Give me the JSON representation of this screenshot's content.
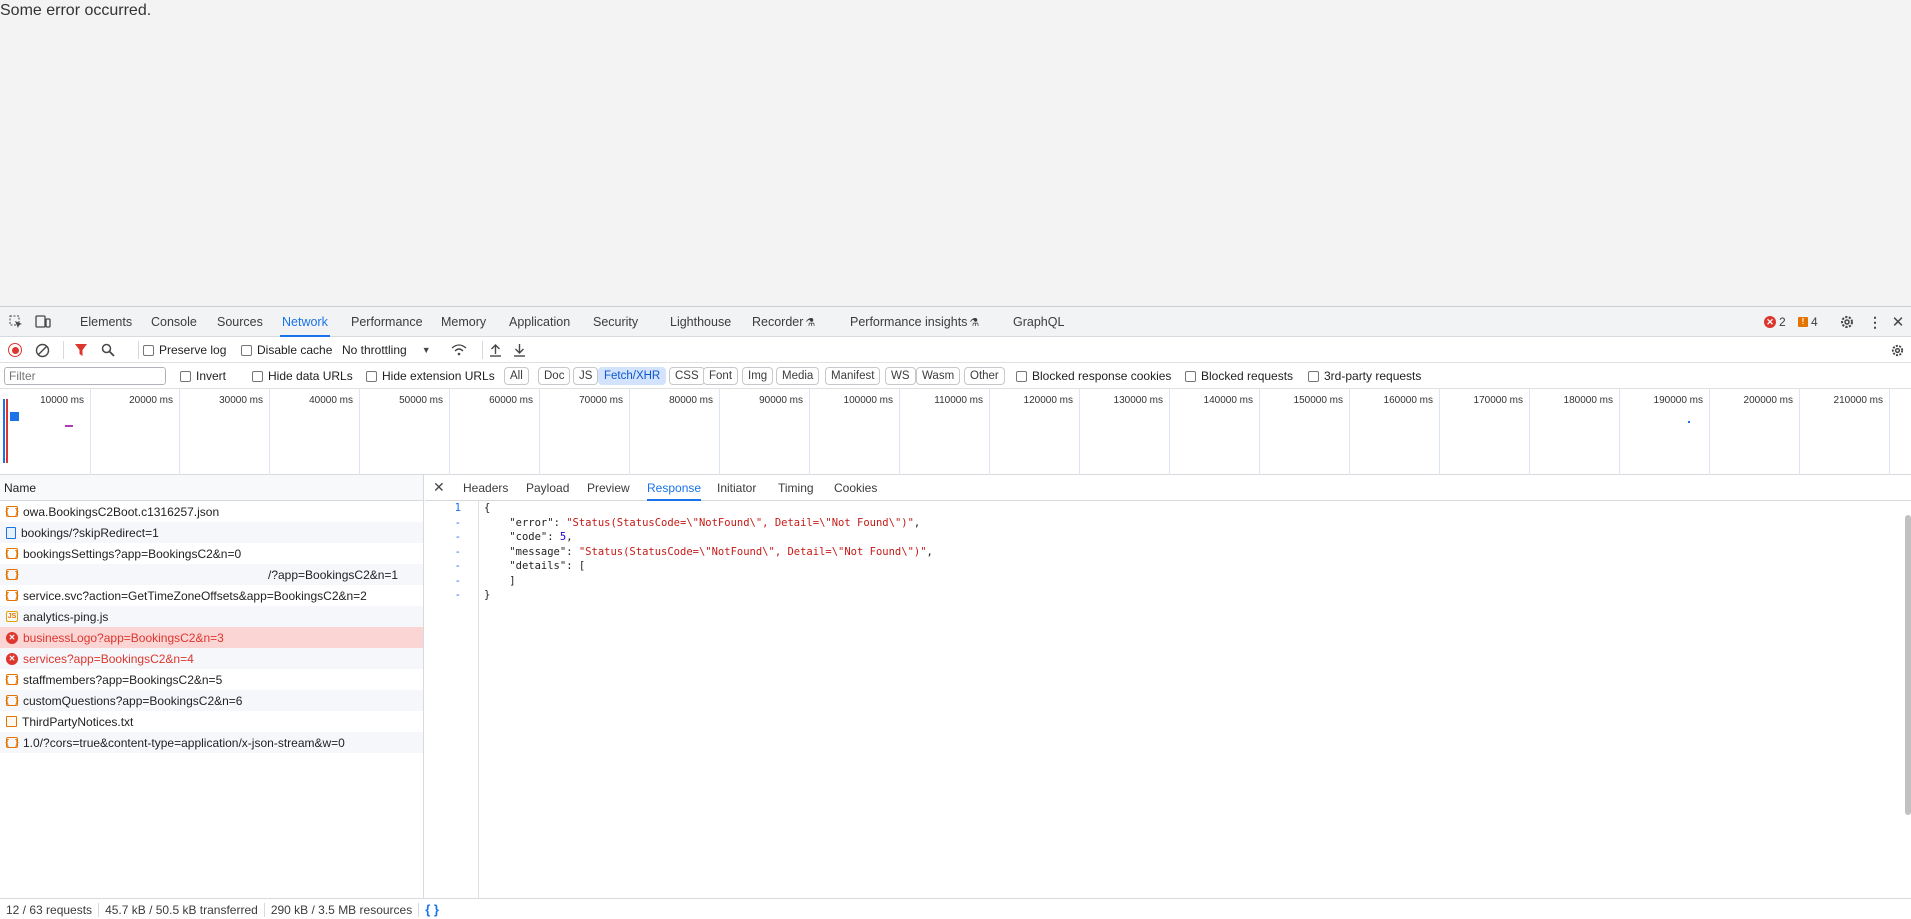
{
  "page": {
    "message": "Some error occurred."
  },
  "tabs": [
    {
      "label": "Elements"
    },
    {
      "label": "Console"
    },
    {
      "label": "Sources"
    },
    {
      "label": "Network"
    },
    {
      "label": "Performance"
    },
    {
      "label": "Memory"
    },
    {
      "label": "Application"
    },
    {
      "label": "Security"
    },
    {
      "label": "Lighthouse"
    },
    {
      "label": "Recorder"
    },
    {
      "label": "Performance insights"
    },
    {
      "label": "GraphQL"
    }
  ],
  "active_tab": "Network",
  "issues": {
    "errors": "2",
    "warnings": "4"
  },
  "toolbar": {
    "preserve_log": "Preserve log",
    "disable_cache": "Disable cache",
    "throttling": "No throttling"
  },
  "filter": {
    "placeholder": "Filter",
    "invert": "Invert",
    "hide_data_urls": "Hide data URLs",
    "hide_extension_urls": "Hide extension URLs",
    "chips": [
      "All",
      "Doc",
      "JS",
      "Fetch/XHR",
      "CSS",
      "Font",
      "Img",
      "Media",
      "Manifest",
      "WS",
      "Wasm",
      "Other"
    ],
    "active_chip": "Fetch/XHR",
    "blocked_response_cookies": "Blocked response cookies",
    "blocked_requests": "Blocked requests",
    "third_party": "3rd-party requests"
  },
  "overview": {
    "ticks": [
      "10000 ms",
      "20000 ms",
      "30000 ms",
      "40000 ms",
      "50000 ms",
      "60000 ms",
      "70000 ms",
      "80000 ms",
      "90000 ms",
      "100000 ms",
      "110000 ms",
      "120000 ms",
      "130000 ms",
      "140000 ms",
      "150000 ms",
      "160000 ms",
      "170000 ms",
      "180000 ms",
      "190000 ms",
      "200000 ms",
      "210000 ms"
    ]
  },
  "requests_header": "Name",
  "requests": [
    {
      "name": "owa.BookingsC2Boot.c1316257.json",
      "type": "xhr",
      "status": "ok"
    },
    {
      "name": "bookings/?skipRedirect=1",
      "type": "doc",
      "status": "ok"
    },
    {
      "name": "bookingsSettings?app=BookingsC2&n=0",
      "type": "xhr",
      "status": "ok"
    },
    {
      "name": "/?app=BookingsC2&n=1",
      "type": "xhr",
      "status": "ok",
      "redacted": true
    },
    {
      "name": "service.svc?action=GetTimeZoneOffsets&app=BookingsC2&n=2",
      "type": "xhr",
      "status": "ok"
    },
    {
      "name": "analytics-ping.js",
      "type": "js",
      "status": "ok"
    },
    {
      "name": "businessLogo?app=BookingsC2&n=3",
      "type": "err",
      "status": "error",
      "selected": true
    },
    {
      "name": "services?app=BookingsC2&n=4",
      "type": "err",
      "status": "error"
    },
    {
      "name": "staffmembers?app=BookingsC2&n=5",
      "type": "xhr",
      "status": "ok"
    },
    {
      "name": "customQuestions?app=BookingsC2&n=6",
      "type": "xhr",
      "status": "ok"
    },
    {
      "name": "ThirdPartyNotices.txt",
      "type": "txt",
      "status": "ok"
    },
    {
      "name": "1.0/?cors=true&content-type=application/x-json-stream&w=0",
      "type": "xhr",
      "status": "ok"
    }
  ],
  "detail_tabs": [
    "Headers",
    "Payload",
    "Preview",
    "Response",
    "Initiator",
    "Timing",
    "Cookies"
  ],
  "active_detail_tab": "Response",
  "response": {
    "line_numbers": [
      "1",
      "-",
      "-",
      "-",
      "-",
      "-",
      "-"
    ],
    "lines": [
      "{",
      "    \"error\": \"Status(StatusCode=\\\"NotFound\\\", Detail=\\\"Not Found\\\")\",",
      "    \"code\": 5,",
      "    \"message\": \"Status(StatusCode=\\\"NotFound\\\", Detail=\\\"Not Found\\\")\",",
      "    \"details\": [",
      "    ]",
      "}"
    ]
  },
  "status": {
    "requests": "12 / 63 requests",
    "transferred": "45.7 kB / 50.5 kB transferred",
    "resources": "290 kB / 3.5 MB resources",
    "pretty_print": "{ }"
  },
  "colors": {
    "accent": "#1a73e8",
    "error": "#dc362e",
    "warning": "#e37400",
    "selected_row": "#fbd5d4"
  }
}
